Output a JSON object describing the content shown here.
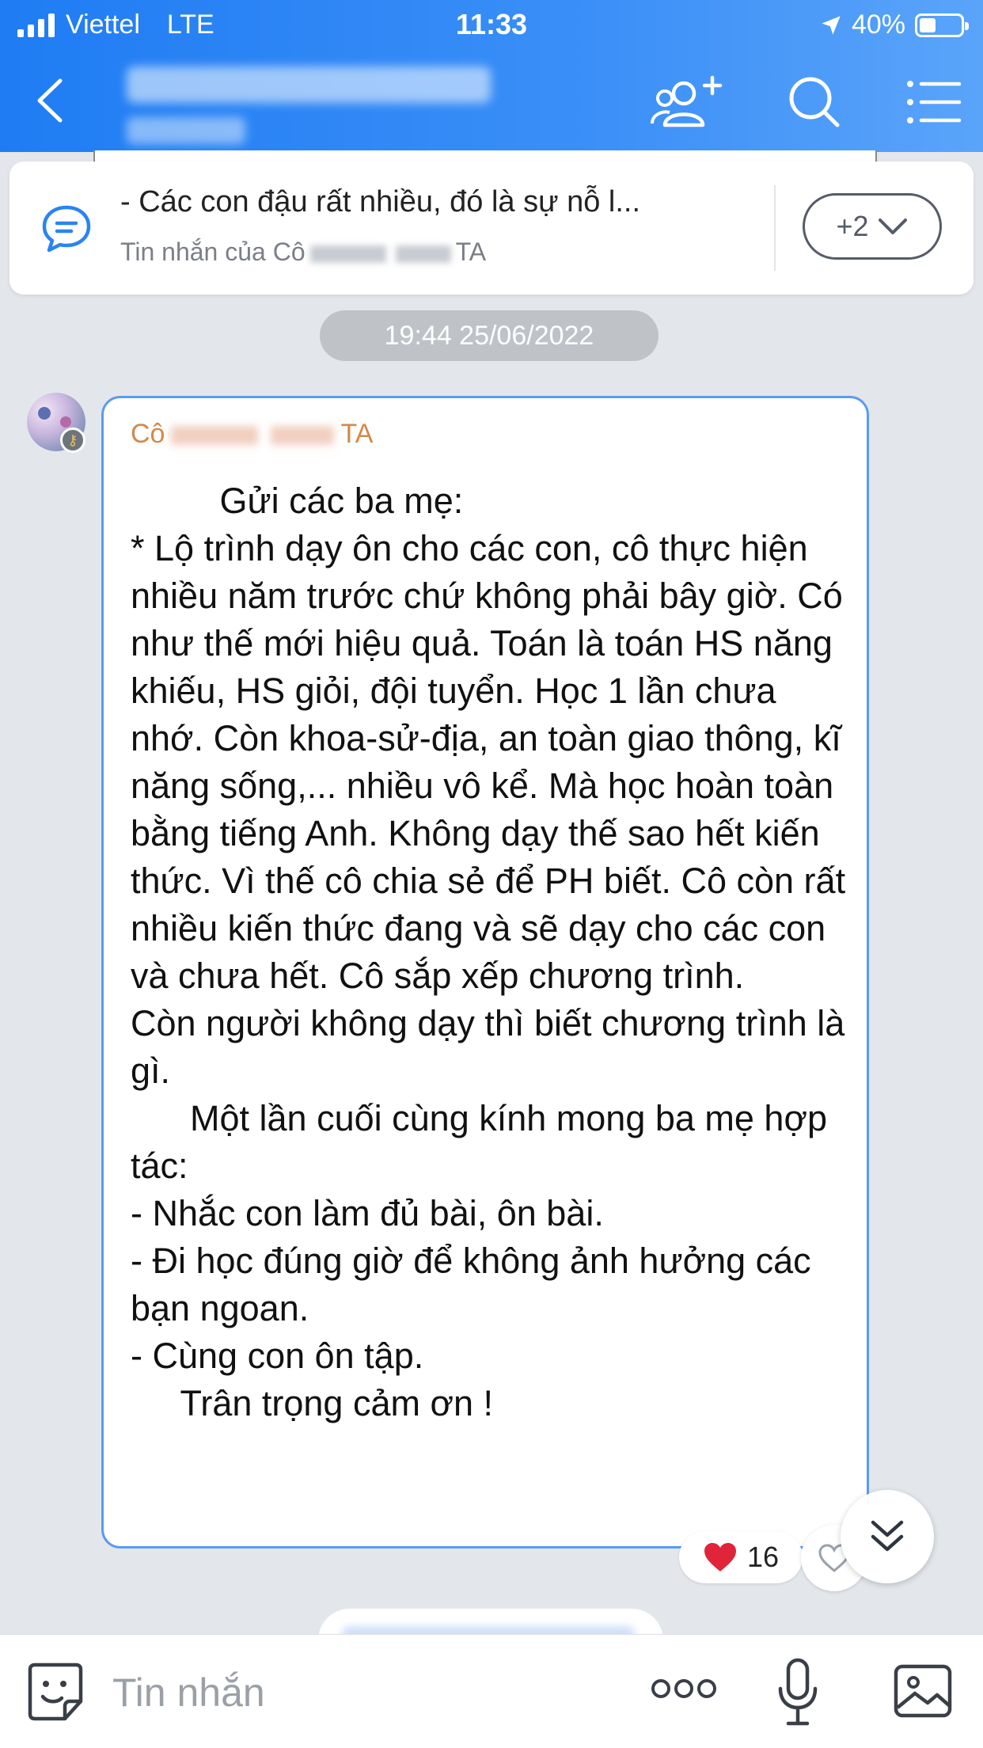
{
  "status_bar": {
    "carrier": "Viettel",
    "network": "LTE",
    "time": "11:33",
    "battery": "40%"
  },
  "pinned": {
    "text": "- Các con đậu rất nhiều, đó là sự nỗ l...",
    "sub_prefix": "Tin nhắn của Cô",
    "sub_suffix": "TA",
    "more_label": "+2"
  },
  "timestamp": "19:44 25/06/2022",
  "message": {
    "sender_prefix": "Cô",
    "sender_suffix": "TA",
    "body": "         Gửi các ba mẹ:\n* Lộ trình dạy ôn cho các con, cô thực hiện nhiều năm trước chứ không phải bây giờ. Có như thế mới hiệu quả. Toán là toán HS năng khiếu, HS giỏi, đội tuyển. Học 1 lần chưa nhớ. Còn khoa-sử-địa, an toàn giao thông, kĩ năng sống,... nhiều vô kể. Mà học hoàn toàn bằng tiếng Anh. Không dạy thế sao hết kiến thức. Vì thế cô chia sẻ để PH biết. Cô còn rất nhiều kiến thức đang và sẽ dạy cho các con và chưa hết. Cô sắp xếp chương trình.\nCòn người không dạy thì biết chương trình là gì.\n      Một lần cuối cùng kính mong ba mẹ hợp tác:\n- Nhắc con làm đủ bài, ôn bài.\n- Đi học đúng giờ để không ảnh hưởng các bạn ngoan.\n- Cùng con ôn tập.\n     Trân trọng cảm ơn !",
    "reaction_count": "16"
  },
  "composer": {
    "placeholder": "Tin nhắn"
  },
  "colors": {
    "header_blue": "#1f7cf3",
    "bubble_border": "#5a9bf2",
    "sender_name": "#d4894a",
    "heart": "#e0243a"
  }
}
